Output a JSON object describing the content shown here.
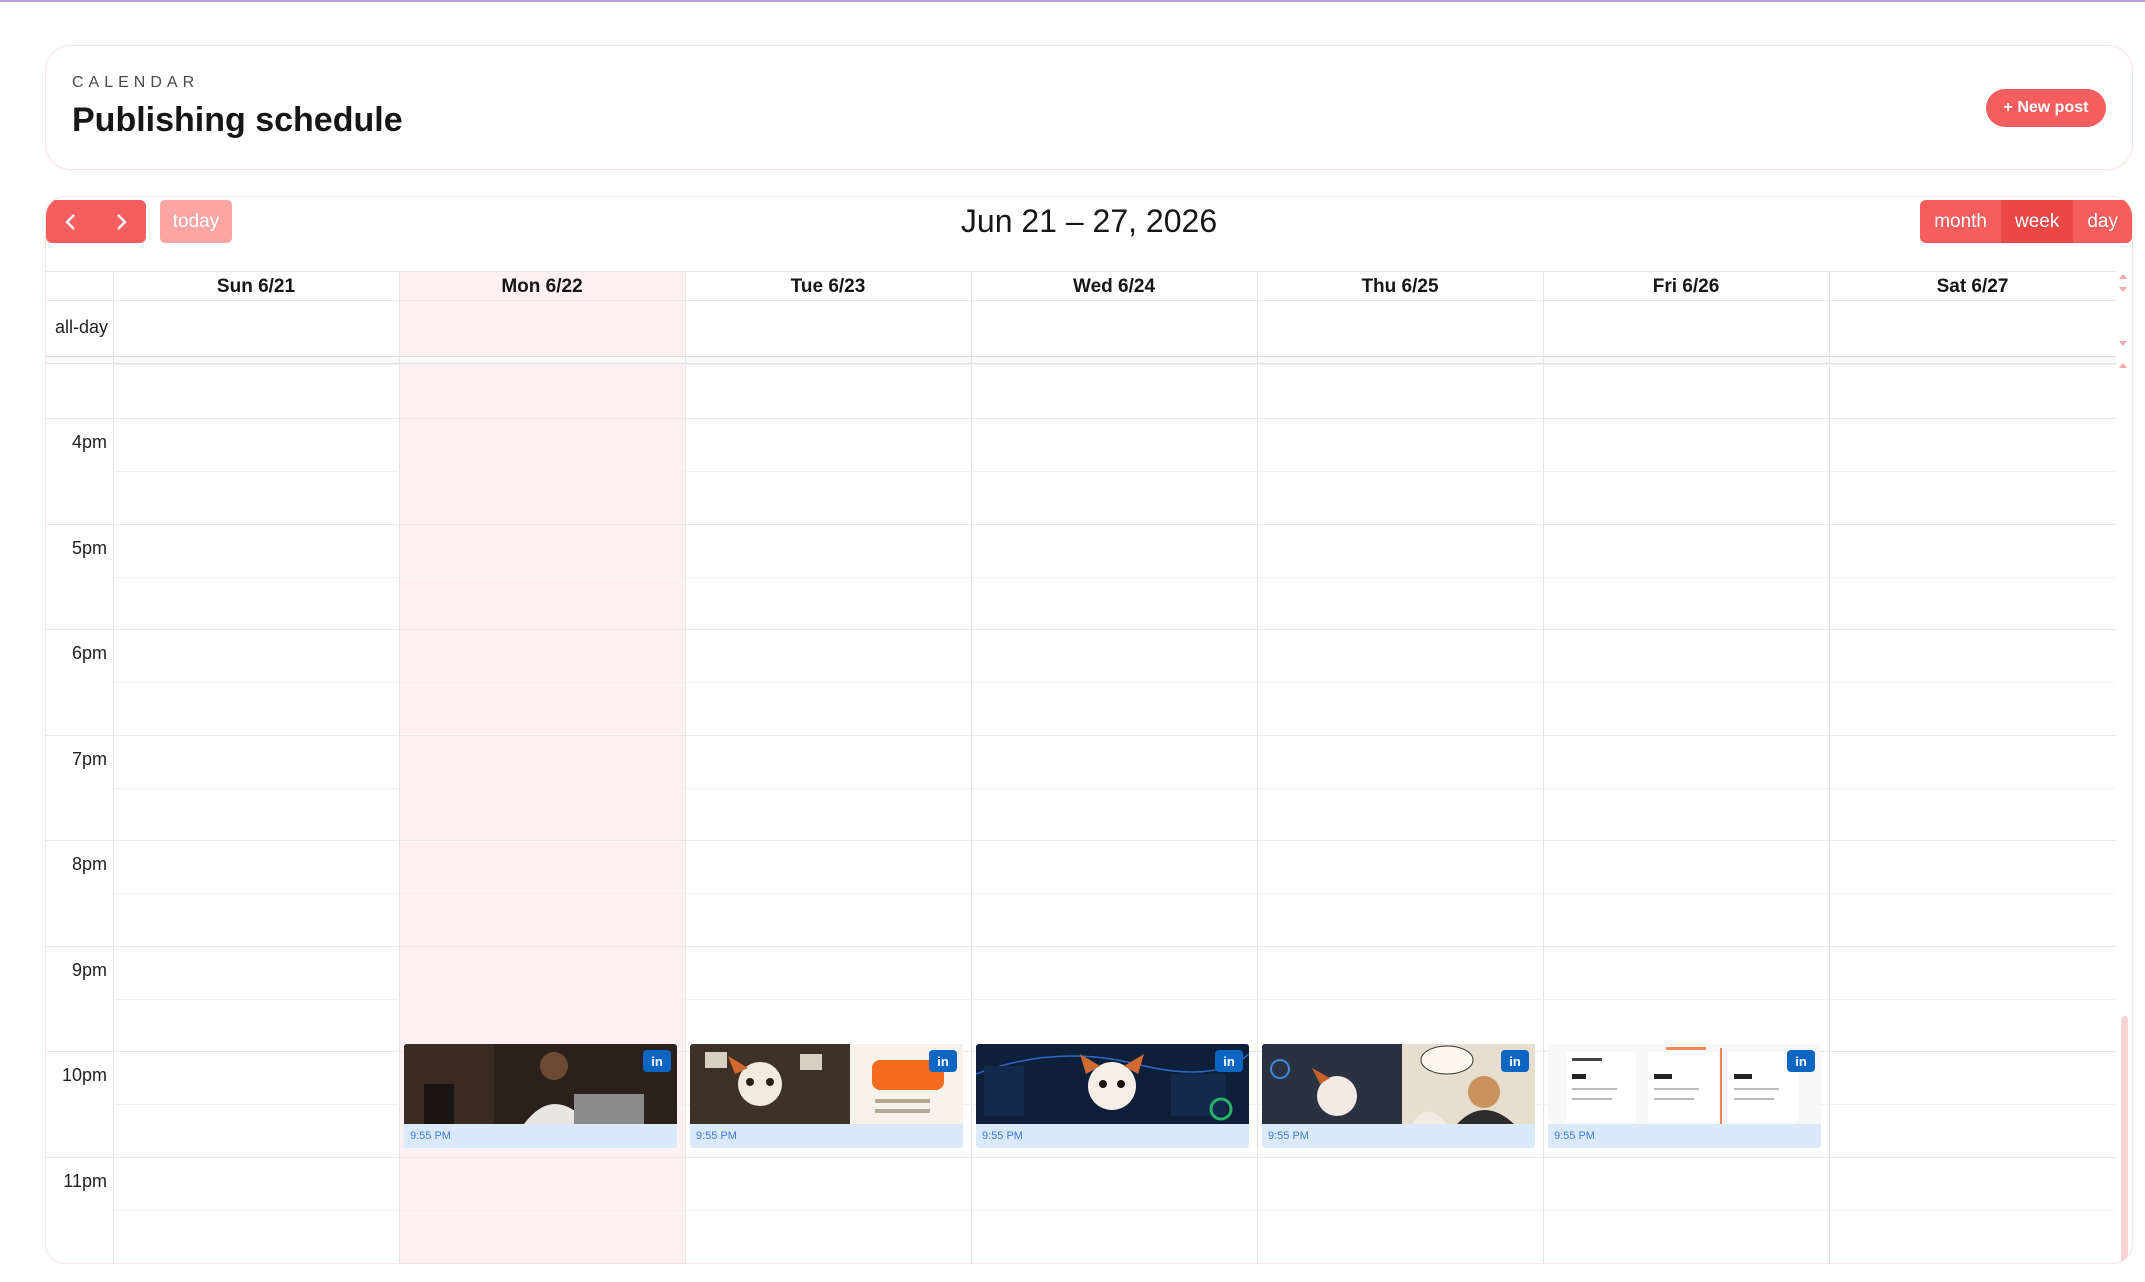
{
  "header": {
    "eyebrow": "CALENDAR",
    "title": "Publishing schedule",
    "new_post_label": "+ New post"
  },
  "toolbar": {
    "prev_icon": "chevron-left-icon",
    "next_icon": "chevron-right-icon",
    "today_label": "today",
    "range_title": "Jun 21 – 27, 2026",
    "views": [
      {
        "label": "month",
        "active": false
      },
      {
        "label": "week",
        "active": true
      },
      {
        "label": "day",
        "active": false
      }
    ]
  },
  "grid": {
    "allday_label": "all-day",
    "days": [
      "Sun 6/21",
      "Mon 6/22",
      "Tue 6/23",
      "Wed 6/24",
      "Thu 6/25",
      "Fri 6/26",
      "Sat 6/27"
    ],
    "today_index": 1,
    "hours": [
      "4pm",
      "5pm",
      "6pm",
      "7pm",
      "8pm",
      "9pm",
      "10pm",
      "11pm"
    ]
  },
  "events": [
    {
      "day": "Mon 6/22",
      "time": "9:55 PM",
      "network": "in",
      "icon": "linkedin-icon"
    },
    {
      "day": "Tue 6/23",
      "time": "9:55 PM",
      "network": "in",
      "icon": "linkedin-icon"
    },
    {
      "day": "Wed 6/24",
      "time": "9:55 PM",
      "network": "in",
      "icon": "linkedin-icon"
    },
    {
      "day": "Thu 6/25",
      "time": "9:55 PM",
      "network": "in",
      "icon": "linkedin-icon"
    },
    {
      "day": "Fri 6/26",
      "time": "9:55 PM",
      "network": "in",
      "icon": "linkedin-icon"
    }
  ],
  "colors": {
    "accent": "#f65e5e",
    "accent_active": "#ec4747",
    "today_bg": "#fff1f1",
    "event_bg": "#dbe9fd",
    "linkedin": "#0a66c2"
  }
}
